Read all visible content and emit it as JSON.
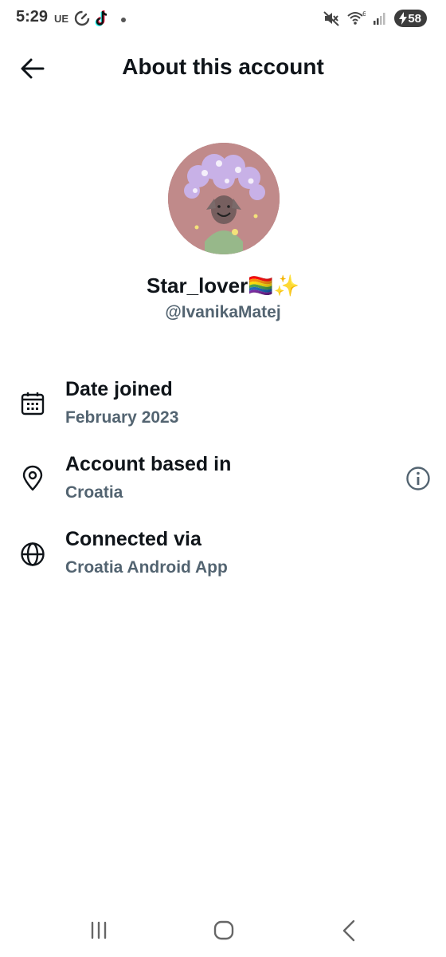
{
  "status_bar": {
    "time": "5:29",
    "carrier_badge": "UE",
    "battery_level": "58",
    "icons": [
      "data-saver-icon",
      "tiktok-icon",
      "notification-dot-icon",
      "mute-icon",
      "wifi-icon",
      "signal-icon",
      "battery-charging-icon"
    ]
  },
  "header": {
    "title": "About this account",
    "back_icon": "arrow-left-icon"
  },
  "profile": {
    "display_name": "Star_lover🏳️‍🌈✨",
    "handle": "@IvanikaMatej"
  },
  "info": {
    "date_joined": {
      "title": "Date joined",
      "value": "February 2023",
      "icon": "calendar-icon"
    },
    "based_in": {
      "title": "Account based in",
      "value": "Croatia",
      "icon": "location-pin-icon",
      "action_icon": "info-icon"
    },
    "connected_via": {
      "title": "Connected via",
      "value": "Croatia Android App",
      "icon": "globe-icon"
    }
  },
  "nav": {
    "icons": [
      "recent-apps-icon",
      "home-icon",
      "back-icon"
    ]
  },
  "colors": {
    "primary_text": "#0f1419",
    "secondary_text": "#536471",
    "background": "#ffffff"
  }
}
